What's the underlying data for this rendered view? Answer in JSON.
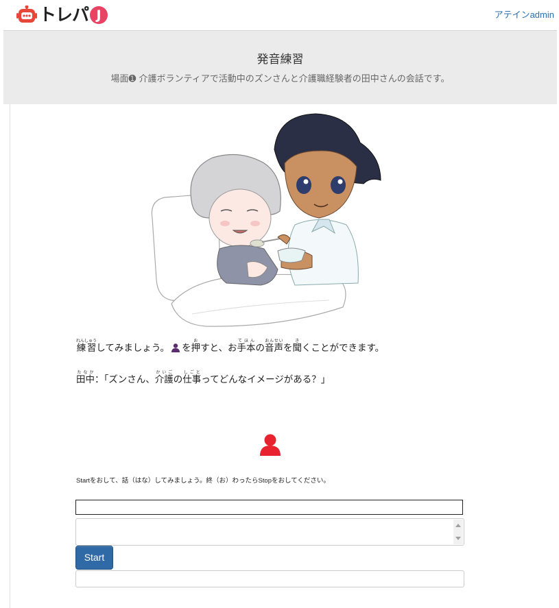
{
  "header": {
    "logo_text": "トレパ",
    "logo_badge": "J",
    "user_link": "アテインadmin"
  },
  "page": {
    "title": "発音練習",
    "subtitle": "場面➊ 介護ボランティアで活動中のズンさんと介護職経験者の田中さんの会話です。"
  },
  "instructions": {
    "line1_word1": "練習",
    "line1_ruby1": "れんしゅう",
    "line1_text1": "してみましょう。",
    "line1_text2": "を",
    "line1_word2": "押",
    "line1_ruby2": "お",
    "line1_text3": "すと、お",
    "line1_word3": "手本",
    "line1_ruby3": "てほん",
    "line1_text4": "の",
    "line1_word4": "音声",
    "line1_ruby4": "おんせい",
    "line1_text5": "を",
    "line1_word5": "聞",
    "line1_ruby5": "き",
    "line1_text6": "くことができます。"
  },
  "dialogue": {
    "speaker": "田中",
    "speaker_ruby": "たなか",
    "text1": "：「ズンさん、",
    "word1": "介護",
    "ruby1": "かいご",
    "text2": "の",
    "word2": "仕事",
    "ruby2": "しごと",
    "text3": "ってどんなイメージがある？」"
  },
  "recorder": {
    "hint": "Startをおして、話（はな）してみましょう。終（お）わったらStopをおしてください。",
    "start_label": "Start",
    "field1_value": "",
    "field2_value": "",
    "field3_value": ""
  },
  "colors": {
    "accent_red": "#e8232f",
    "logo_pink": "#e84363",
    "button_blue": "#2f6aa6",
    "link_blue": "#2a6fb2"
  },
  "icons": {
    "record": "user-icon",
    "inline": "user-icon"
  }
}
